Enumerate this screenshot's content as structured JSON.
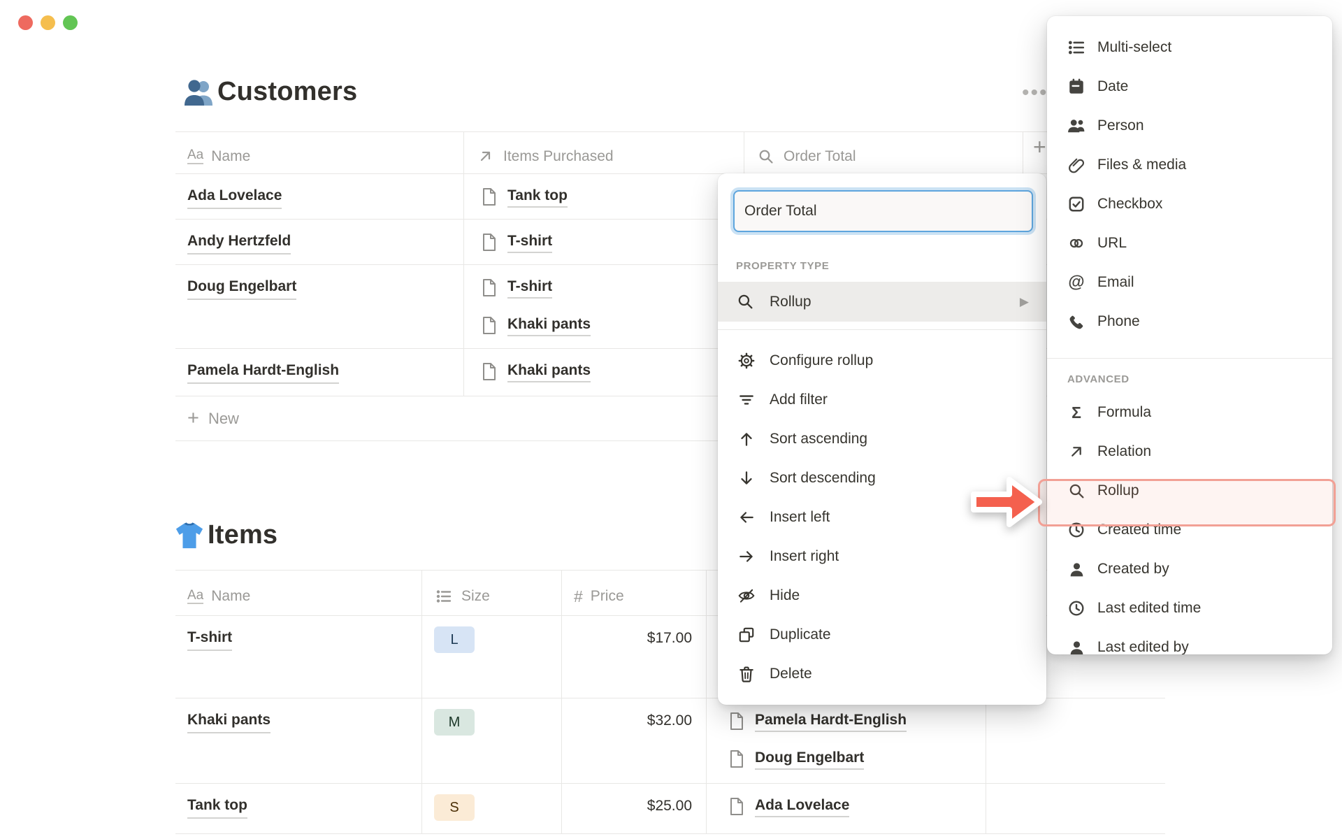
{
  "icons": {
    "aa": "Aa",
    "hash": "#",
    "at_glyph": "@",
    "sigma": "Σ",
    "plus": "+",
    "more_dots": "•••",
    "chevron_right": "▶"
  },
  "customers_section": {
    "title": "Customers",
    "table": {
      "columns": [
        {
          "label": "Name"
        },
        {
          "label": "Items Purchased"
        },
        {
          "label": "Order Total"
        }
      ],
      "rows": [
        {
          "name": "Ada Lovelace",
          "items": [
            "Tank top"
          ]
        },
        {
          "name": "Andy Hertzfeld",
          "items": [
            "T-shirt"
          ]
        },
        {
          "name": "Doug Engelbart",
          "items": [
            "T-shirt",
            "Khaki pants"
          ]
        },
        {
          "name": "Pamela Hardt-English",
          "items": [
            "Khaki pants"
          ]
        }
      ],
      "new_row_label": "New"
    }
  },
  "items_section": {
    "title": "Items",
    "table": {
      "columns": [
        {
          "label": "Name"
        },
        {
          "label": "Size"
        },
        {
          "label": "Price"
        }
      ],
      "rows": [
        {
          "name": "T-shirt",
          "size": "L",
          "size_bg": "#D7E4F5",
          "size_fg": "#1D3A54",
          "price": "$17.00",
          "customers": []
        },
        {
          "name": "Khaki pants",
          "size": "M",
          "size_bg": "#D9E7E0",
          "size_fg": "#1C3829",
          "price": "$32.00",
          "customers": [
            "Pamela Hardt-English",
            "Doug Engelbart"
          ]
        },
        {
          "name": "Tank top",
          "size": "S",
          "size_bg": "#FBEBD6",
          "size_fg": "#4C3007",
          "price": "$25.00",
          "customers": [
            "Ada Lovelace"
          ]
        }
      ]
    }
  },
  "property_menu": {
    "name_value": "Order Total",
    "section_label": "PROPERTY TYPE",
    "selected_type": "Rollup",
    "actions": [
      "Configure rollup",
      "Add filter",
      "Sort ascending",
      "Sort descending",
      "Insert left",
      "Insert right",
      "Hide",
      "Duplicate",
      "Delete"
    ]
  },
  "type_panel": {
    "basic_items": [
      "Multi-select",
      "Date",
      "Person",
      "Files & media",
      "Checkbox",
      "URL",
      "Email",
      "Phone"
    ],
    "advanced_label": "ADVANCED",
    "advanced_items": [
      "Formula",
      "Relation",
      "Rollup",
      "Created time",
      "Created by",
      "Last edited time",
      "Last edited by"
    ],
    "highlighted_item": "Rollup"
  },
  "colors": {
    "arrow": "#F4604E",
    "highlight_border": "#F2A095",
    "focus_ring": "#5EA5DD",
    "text": "#37352F",
    "muted": "#9B9A97",
    "grid": "#E8E7E5",
    "traffic_red": "#EE6A5F",
    "traffic_yellow": "#F5BE4E",
    "traffic_green": "#62C554"
  }
}
